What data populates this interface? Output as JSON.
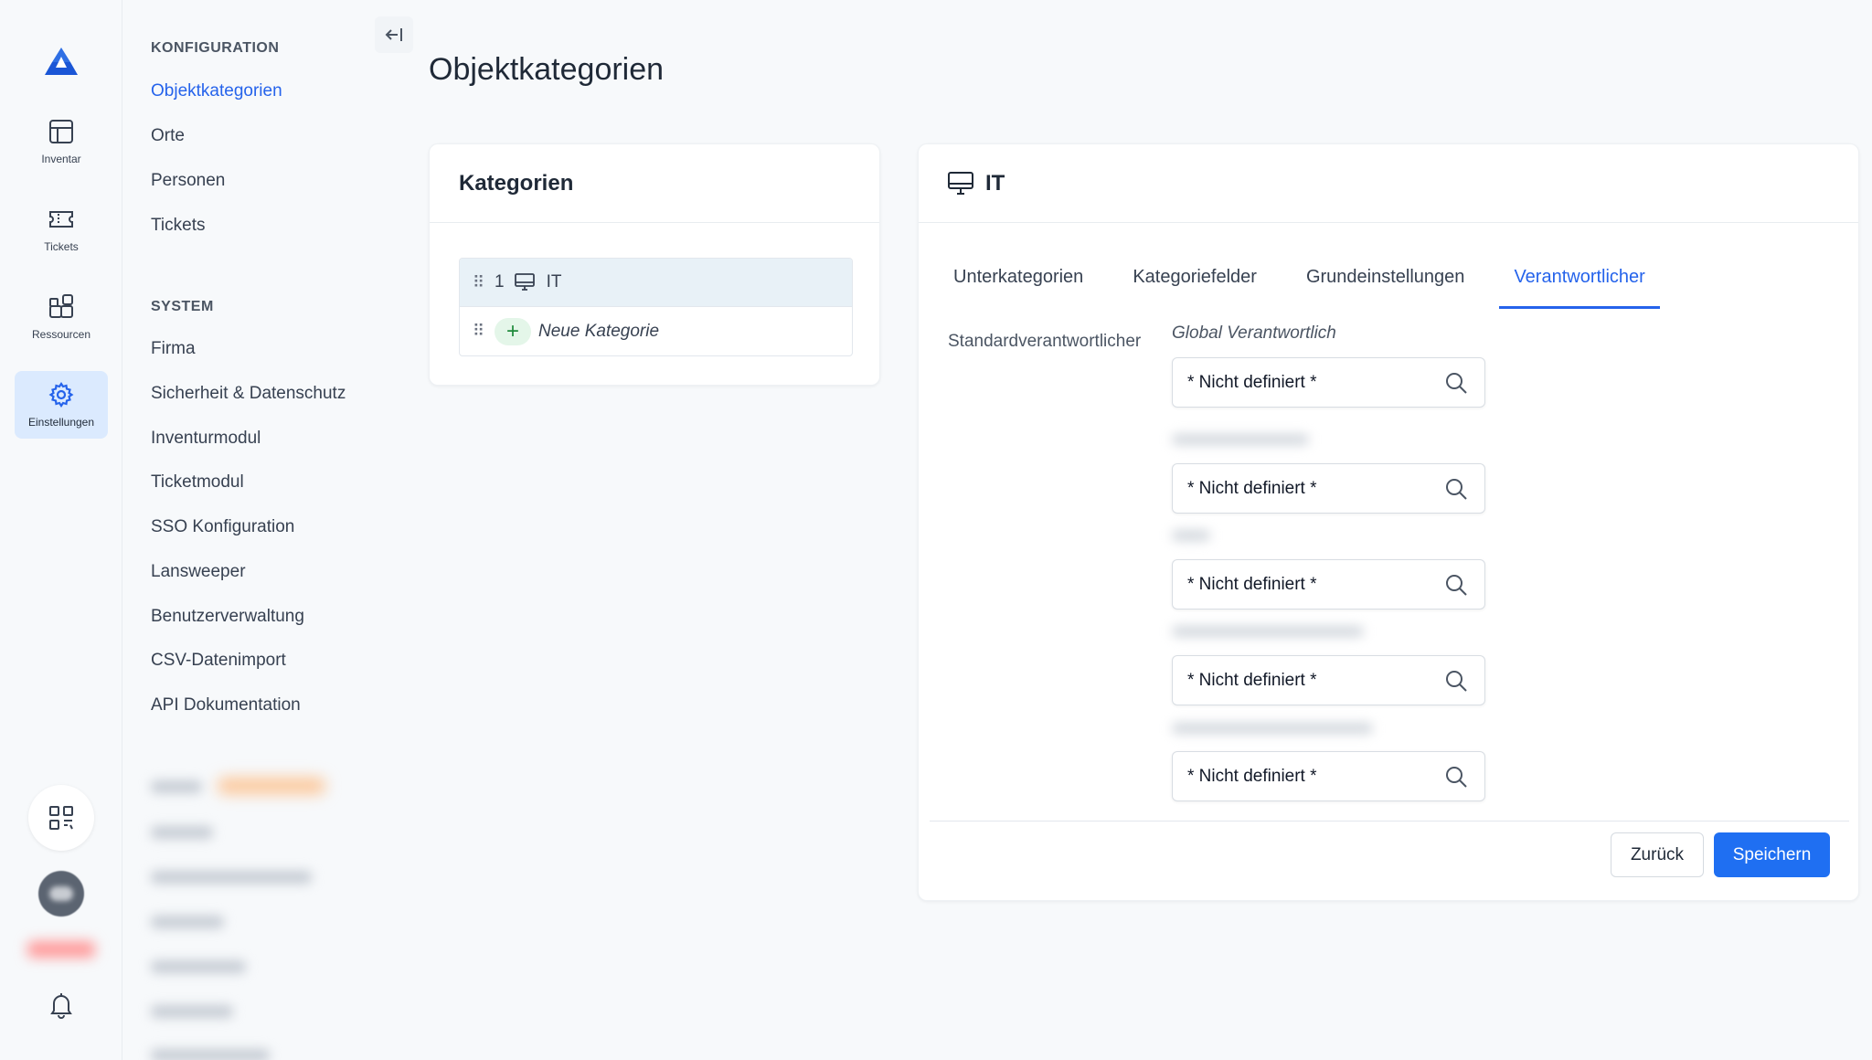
{
  "rail": {
    "items": [
      {
        "label": "Inventar",
        "icon": "grid-icon"
      },
      {
        "label": "Tickets",
        "icon": "ticket-icon"
      },
      {
        "label": "Ressourcen",
        "icon": "resources-icon"
      },
      {
        "label": "Einstellungen",
        "icon": "gear-icon",
        "active": true
      }
    ]
  },
  "confnav": {
    "section1": "KONFIGURATION",
    "section1_items": [
      "Objektkategorien",
      "Orte",
      "Personen",
      "Tickets"
    ],
    "section2": "SYSTEM",
    "section2_items": [
      "Firma",
      "Sicherheit & Datenschutz",
      "Inventurmodul",
      "Ticketmodul",
      "SSO Konfiguration",
      "Lansweeper",
      "Benutzerverwaltung",
      "CSV-Datenimport",
      "API Dokumentation"
    ]
  },
  "page": {
    "title": "Objektkategorien"
  },
  "categories_card": {
    "title": "Kategorien",
    "rows": [
      {
        "num": "1",
        "label": "IT"
      }
    ],
    "new_label": "Neue Kategorie"
  },
  "detail_card": {
    "title": "IT",
    "tabs": [
      "Unterkategorien",
      "Kategoriefelder",
      "Grundeinstellungen",
      "Verantwortlicher"
    ],
    "active_tab": "Verantwortlicher",
    "field_label": "Standardverantwortlicher",
    "group_label": "Global Verantwortlich",
    "select_value": "* Nicht definiert *",
    "back_label": "Zurück",
    "save_label": "Speichern"
  },
  "colors": {
    "accent": "#2563eb",
    "primary_button": "#1f6ff2",
    "active_rail": "#dbeafe"
  }
}
